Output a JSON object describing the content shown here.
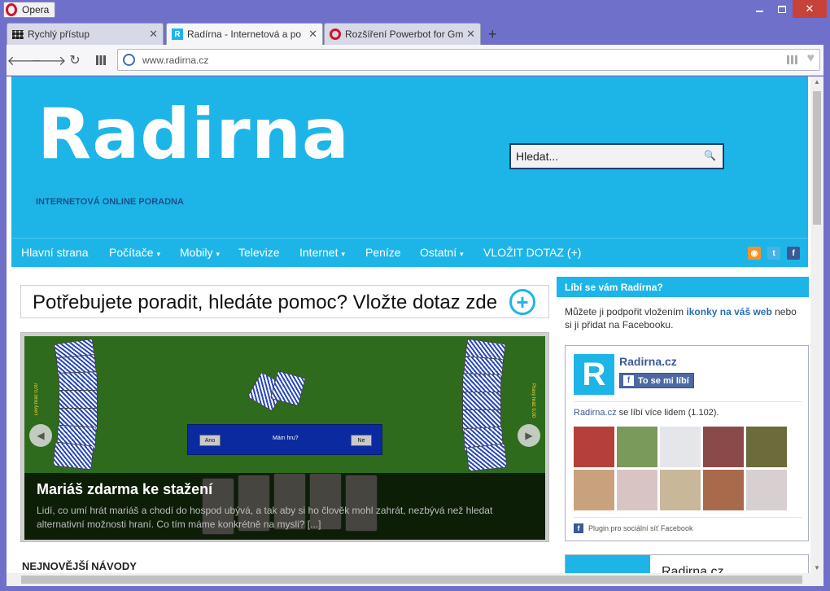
{
  "browser": {
    "menu_label": "Opera",
    "tabs": [
      {
        "label": "Rychlý přístup"
      },
      {
        "label": "Radírna - Internetová a po"
      },
      {
        "label": "Rozšíření Powerbot for Gm"
      }
    ],
    "url": "www.radirna.cz"
  },
  "site": {
    "logo_text": "Radirna",
    "tagline": "INTERNETOVÁ ONLINE PORADNA",
    "search_placeholder": "Hledat...",
    "menu": [
      {
        "label": "Hlavní strana",
        "dropdown": false
      },
      {
        "label": "Počítače",
        "dropdown": true
      },
      {
        "label": "Mobily",
        "dropdown": true
      },
      {
        "label": "Televize",
        "dropdown": false
      },
      {
        "label": "Internet",
        "dropdown": true
      },
      {
        "label": "Peníze",
        "dropdown": false
      },
      {
        "label": "Ostatní",
        "dropdown": true
      },
      {
        "label": "VLOŽIT DOTAZ (+)",
        "dropdown": false
      }
    ],
    "social": [
      "rss-icon",
      "twitter-icon",
      "facebook-icon"
    ],
    "arrow_glyph": "▾"
  },
  "main": {
    "cta_text": "Potřebujete poradit, hledáte pomoc? Vložte dotaz zde",
    "slide": {
      "title": "Mariáš zdarma ke stažení",
      "description": "Lidí, co umí hrát mariáš a chodí do hospod ubývá, a tak aby si ho člověk mohl zahrát, nezbývá než hledat alternativní možnosti hraní. Co tím máme konkrétně na mysli? [...]",
      "game_dialog": {
        "question": "Mám hru?",
        "yes": "Ano",
        "no": "Ne"
      },
      "left_player": "Levý hráč 0,00",
      "right_player": "Pravý hráč 0,00"
    },
    "section_heading": "NEJNOVĚJŠÍ NÁVODY"
  },
  "sidebar": {
    "heading": "Líbí se vám Radírna?",
    "text_before": "Můžete ji podpořit vložením ",
    "text_link": "ikonky na váš web",
    "text_after": " nebo si ji přidat na Facebooku.",
    "fb": {
      "logo_letter": "R",
      "page_name": "Radirna.cz",
      "like_label": "To se mi líbí",
      "count_link": "Radirna.cz",
      "count_text": " se líbí více lidem (1.102).",
      "plugin_text": "Plugin pro sociální síť Facebook",
      "faces": 10
    },
    "second_box_title": "Radirna.cz"
  },
  "colors": {
    "brand": "#1db5e8",
    "nav_dark": "#1b4f86",
    "facebook": "#3b5998",
    "window": "#6f70c9"
  }
}
